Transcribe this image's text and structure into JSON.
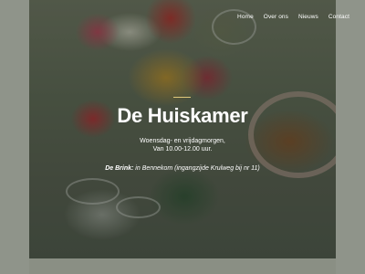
{
  "nav": {
    "items": [
      "Home",
      "Over ons",
      "Nieuws",
      "Contact"
    ]
  },
  "hero": {
    "title": "De Huiskamer",
    "line1": "Woensdag- en vrijdagmorgen,",
    "line2": "Van 10.00-12.00 uur.",
    "location_label": "De Brink:",
    "location_text": " in Bennekom (ingangzijde Krulweg bij nr 11)"
  },
  "colors": {
    "accent_divider": "#e0c87a",
    "text": "#ffffff",
    "frame": "#8f948a"
  }
}
